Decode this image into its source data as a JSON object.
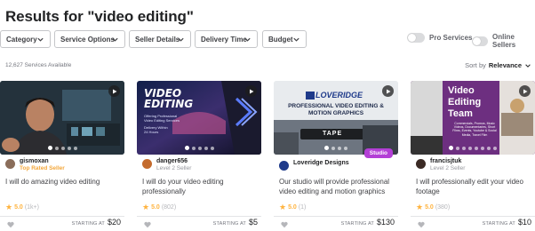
{
  "title": "Results for \"video editing\"",
  "filters": [
    "Category",
    "Service Options",
    "Seller Details",
    "Delivery Time",
    "Budget"
  ],
  "toggles": [
    "Pro Services",
    "Online Sellers"
  ],
  "count": "12,627 Services Available",
  "sort": {
    "label": "Sort by",
    "value": "Relevance"
  },
  "starting_label": "STARTING AT",
  "cards": [
    {
      "seller": "gismoxan",
      "level": "Top Rated Seller",
      "description": "I will do amazing video editing",
      "rating": "5.0",
      "reviews": "(1k+)",
      "price": "$20",
      "thumb_text": "",
      "active_dot": 0,
      "dots": 5
    },
    {
      "seller": "danger656",
      "level": "Level 2 Seller",
      "description": "I will do your video editing professionally",
      "rating": "5.0",
      "reviews": "(802)",
      "price": "$5",
      "thumb_text": "VIDEO EDITING",
      "thumb_sub": "Offering Professional Video Editing Services",
      "thumb_sub2": "Delivery Within 24 Hours",
      "active_dot": 0,
      "dots": 5
    },
    {
      "seller": "Loveridge Designs",
      "level": "",
      "description": "Our studio will provide professional video editing and motion graphics",
      "rating": "5.0",
      "reviews": "(1)",
      "price": "$130",
      "brand": "LOVERIDGE",
      "thumb_text": "PROFESSIONAL VIDEO EDITING & MOTION GRAPHICS",
      "thumb_tape": "TAPE",
      "badge": "Studio",
      "active_dot": 0,
      "dots": 4
    },
    {
      "seller": "francisjtuk",
      "level": "Level 2 Seller",
      "description": "I will professionally edit your video footage",
      "rating": "5.0",
      "reviews": "(380)",
      "price": "$10",
      "thumb_text": "Video Editing Team",
      "thumb_sub": "Commercials, Promos, Music Videos, Documentaries, Short Films, Events, Youtube & Social Media, Travel Film",
      "active_dot": 0,
      "dots": 8
    }
  ],
  "colors": {
    "accent_star": "#ffb33e",
    "top_rated": "#f3a73b",
    "studio": "#b33fd6"
  }
}
